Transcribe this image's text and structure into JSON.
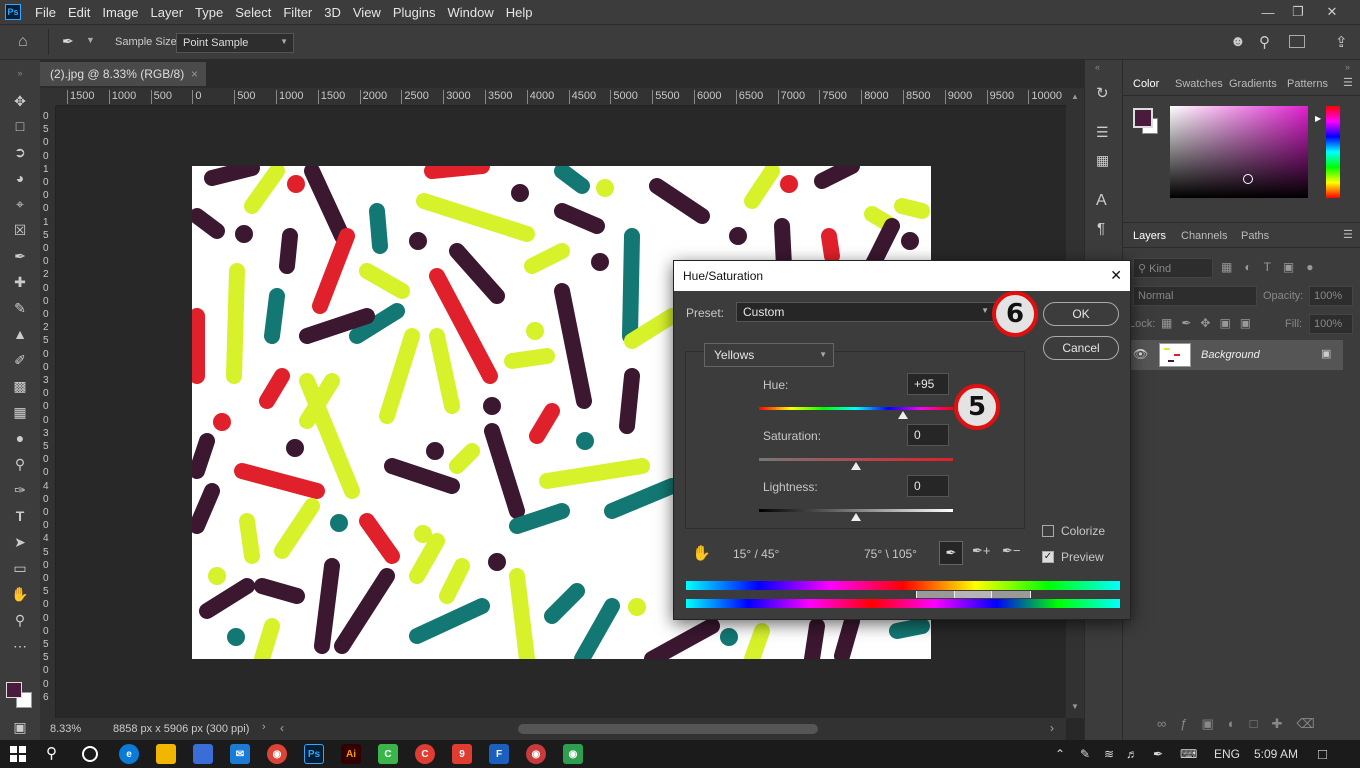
{
  "menu": [
    "File",
    "Edit",
    "Image",
    "Layer",
    "Type",
    "Select",
    "Filter",
    "3D",
    "View",
    "Plugins",
    "Window",
    "Help"
  ],
  "app_badge": "Ps",
  "options": {
    "sample_size_label": "Sample Size:",
    "sample_size_value": "Point Sample"
  },
  "document": {
    "tab_title": "(2).jpg @ 8.33% (RGB/8)",
    "zoom": "8.33%",
    "info": "8858 px x 5906 px (300 ppi)"
  },
  "ruler_h": [
    "1500",
    "1000",
    "500",
    "0",
    "500",
    "1000",
    "1500",
    "2000",
    "2500",
    "3000",
    "3500",
    "4000",
    "4500",
    "5000",
    "5500",
    "6000",
    "6500",
    "7000",
    "7500",
    "8000",
    "8500",
    "9000",
    "9500",
    "10000"
  ],
  "ruler_v": [
    "0",
    "5",
    "0",
    "0",
    "1",
    "0",
    "0",
    "0",
    "1",
    "5",
    "0",
    "0",
    "2",
    "0",
    "0",
    "0",
    "2",
    "5",
    "0",
    "0",
    "3",
    "0",
    "0",
    "0",
    "3",
    "5",
    "0",
    "0",
    "4",
    "0",
    "0",
    "0",
    "4",
    "5",
    "0",
    "0",
    "5",
    "0",
    "0",
    "0",
    "5",
    "5",
    "0",
    "0",
    "6"
  ],
  "dialog": {
    "title": "Hue/Saturation",
    "preset_label": "Preset:",
    "preset_value": "Custom",
    "ok_label": "OK",
    "cancel_label": "Cancel",
    "channel": "Yellows",
    "hue_label": "Hue:",
    "hue_value": "+95",
    "saturation_label": "Saturation:",
    "saturation_value": "0",
    "lightness_label": "Lightness:",
    "lightness_value": "0",
    "range_left": "15° / 45°",
    "range_right": "75° \\ 105°",
    "colorize_label": "Colorize",
    "colorize_checked": false,
    "preview_label": "Preview",
    "preview_checked": true,
    "hue_slider_fraction": 0.74,
    "saturation_slider_fraction": 0.5,
    "lightness_slider_fraction": 0.5
  },
  "annotations": {
    "step5": "5",
    "step6": "6"
  },
  "color_panel": {
    "tabs": [
      "Color",
      "Swatches",
      "Gradients",
      "Patterns"
    ],
    "foreground": "#4a1b3d"
  },
  "layers_panel": {
    "tabs": [
      "Layers",
      "Channels",
      "Paths"
    ],
    "filter_placeholder": "Kind",
    "blend_mode": "Normal",
    "opacity_label": "Opacity:",
    "opacity_value": "100%",
    "lock_label": "Lock:",
    "fill_label": "Fill:",
    "fill_value": "100%",
    "layer_name": "Background"
  },
  "taskbar": {
    "language": "ENG",
    "time": "5:09 AM"
  },
  "colors": {
    "accent_red": "#e01010",
    "plum": "#3b1730",
    "lime": "#d7f22b",
    "red": "#e0202a",
    "teal": "#137873"
  }
}
